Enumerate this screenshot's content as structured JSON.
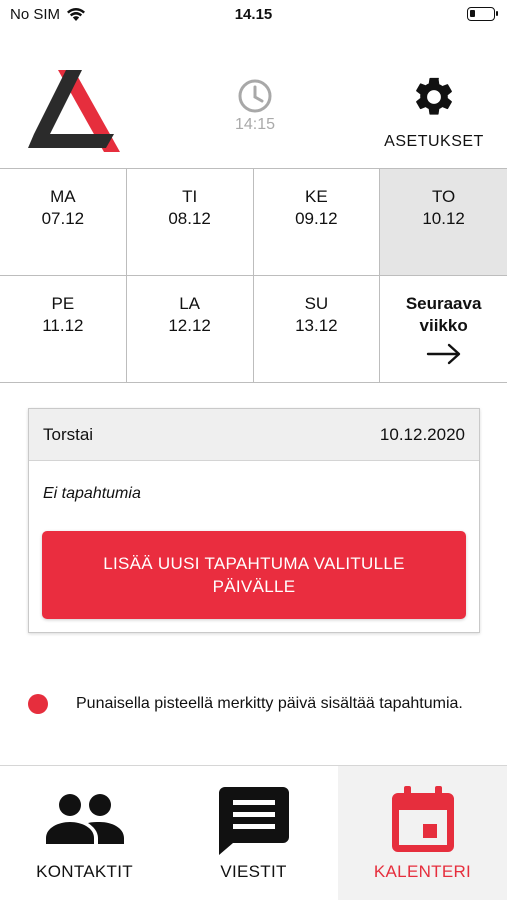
{
  "status_bar": {
    "carrier": "No SIM",
    "time": "14.15"
  },
  "header": {
    "clock_time": "14:15",
    "settings_label": "ASETUKSET"
  },
  "week": {
    "days": [
      {
        "weekday": "MA",
        "date": "07.12",
        "selected": false
      },
      {
        "weekday": "TI",
        "date": "08.12",
        "selected": false
      },
      {
        "weekday": "KE",
        "date": "09.12",
        "selected": false
      },
      {
        "weekday": "TO",
        "date": "10.12",
        "selected": true
      },
      {
        "weekday": "PE",
        "date": "11.12",
        "selected": false
      },
      {
        "weekday": "LA",
        "date": "12.12",
        "selected": false
      },
      {
        "weekday": "SU",
        "date": "13.12",
        "selected": false
      }
    ],
    "next_week_line1": "Seuraava",
    "next_week_line2": "viikko"
  },
  "event_card": {
    "day_name": "Torstai",
    "date": "10.12.2020",
    "empty_text": "Ei tapahtumia",
    "add_button_line1": "LISÄÄ UUSI TAPAHTUMA VALITULLE",
    "add_button_line2": "PÄIVÄLLE"
  },
  "legend": {
    "text": "Punaisella pisteellä merkitty päivä sisältää tapahtumia."
  },
  "tabs": [
    {
      "label": "KONTAKTIT",
      "icon": "contacts-icon",
      "active": false
    },
    {
      "label": "VIESTIT",
      "icon": "messages-icon",
      "active": false
    },
    {
      "label": "KALENTERI",
      "icon": "calendar-icon",
      "active": true
    }
  ],
  "colors": {
    "accent": "#ea2d3f",
    "selected_day_bg": "#e5e5e5",
    "logo_dark": "#2b2b2b",
    "logo_red": "#e62e3d"
  }
}
